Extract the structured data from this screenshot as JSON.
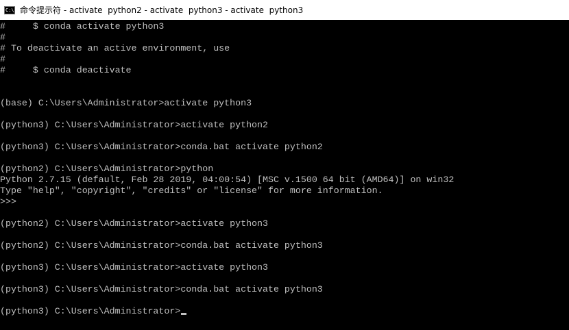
{
  "window": {
    "title": "命令提示符 - activate  python2 - activate  python3 - activate  python3",
    "icon": "cmd-console-icon",
    "icon_text": "C:\\"
  },
  "console": {
    "lines": [
      "#     $ conda activate python3",
      "#",
      "# To deactivate an active environment, use",
      "#",
      "#     $ conda deactivate",
      "",
      "",
      "(base) C:\\Users\\Administrator>activate python3",
      "",
      "(python3) C:\\Users\\Administrator>activate python2",
      "",
      "(python3) C:\\Users\\Administrator>conda.bat activate python2",
      "",
      "(python2) C:\\Users\\Administrator>python",
      "Python 2.7.15 (default, Feb 28 2019, 04:00:54) [MSC v.1500 64 bit (AMD64)] on win32",
      "Type \"help\", \"copyright\", \"credits\" or \"license\" for more information.",
      ">>>",
      "",
      "(python2) C:\\Users\\Administrator>activate python3",
      "",
      "(python2) C:\\Users\\Administrator>conda.bat activate python3",
      "",
      "(python3) C:\\Users\\Administrator>activate python3",
      "",
      "(python3) C:\\Users\\Administrator>conda.bat activate python3",
      "",
      "(python3) C:\\Users\\Administrator>"
    ]
  },
  "colors": {
    "background": "#000000",
    "foreground": "#c0c0c0",
    "titlebar": "#ffffff"
  }
}
